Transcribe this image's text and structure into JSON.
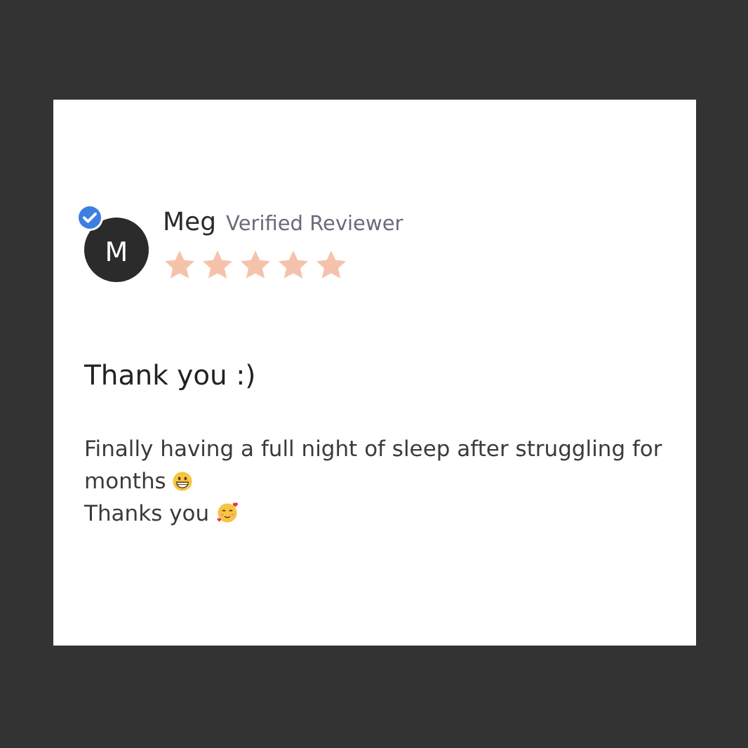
{
  "review": {
    "avatar_initial": "M",
    "verified": true,
    "author": "Meg",
    "author_label": "Verified Reviewer",
    "stars": 5,
    "title": "Thank you :)",
    "body": [
      {
        "text": "Finally having a full night of sleep after struggling for",
        "kind": "plain"
      },
      {
        "text": "months",
        "kind": "grin"
      },
      {
        "text": "Thanks you",
        "kind": "hearts"
      }
    ]
  }
}
